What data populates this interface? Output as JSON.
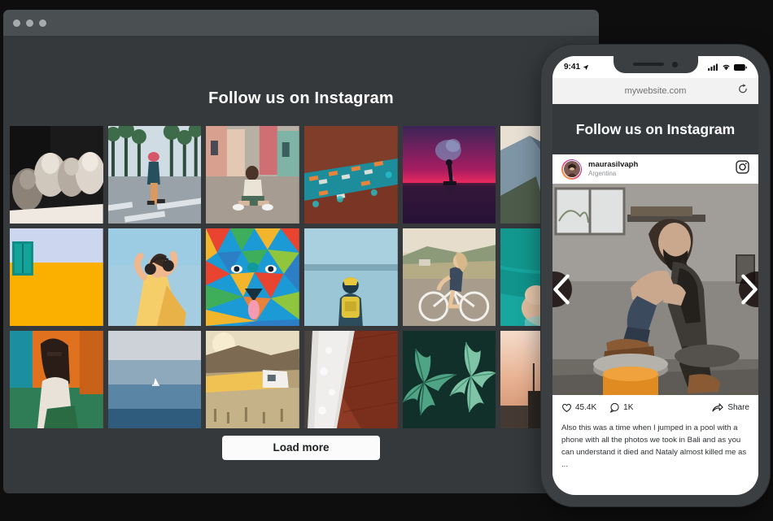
{
  "browser": {
    "title_bar_dots": 3,
    "heading": "Follow us on Instagram",
    "load_more_label": "Load more"
  },
  "photo_grid": {
    "columns": 6,
    "rows": 3,
    "tiles": [
      {
        "id": "tile-1",
        "alt": "Four friends laughing, black and white",
        "palette": [
          "#1b1b1b",
          "#d8d2cb",
          "#8a8075"
        ]
      },
      {
        "id": "tile-2",
        "alt": "Woman crossing palm-lined street",
        "palette": [
          "#c9d6de",
          "#2c4a5c",
          "#d9a06a"
        ]
      },
      {
        "id": "tile-3",
        "alt": "Woman sitting on colorful street",
        "palette": [
          "#cf8f7e",
          "#7ea9a0",
          "#b9b0a4"
        ]
      },
      {
        "id": "tile-4",
        "alt": "Aerial view of city traffic at dusk",
        "palette": [
          "#7a3b2c",
          "#1f9aa8",
          "#e0762f"
        ]
      },
      {
        "id": "tile-5",
        "alt": "Silhouette with smoke flare at sunset",
        "palette": [
          "#3a2050",
          "#e0255e",
          "#1b1030"
        ]
      },
      {
        "id": "tile-6",
        "alt": "Woman looking at mountain cliff",
        "palette": [
          "#e8ddd2",
          "#8fa6b5",
          "#4f5c52"
        ]
      },
      {
        "id": "tile-7",
        "alt": "Yellow wall with teal window",
        "palette": [
          "#ccd6ef",
          "#fbb000",
          "#0e8b84"
        ]
      },
      {
        "id": "tile-8",
        "alt": "Woman in yellow dress with headphones",
        "palette": [
          "#9cc8e0",
          "#f6cf6d",
          "#e8a24a"
        ]
      },
      {
        "id": "tile-9",
        "alt": "Geometric colorful bear mural",
        "palette": [
          "#e8442f",
          "#1b9ad6",
          "#3fae5a"
        ]
      },
      {
        "id": "tile-10",
        "alt": "Hiker with yellow backpack at lake",
        "palette": [
          "#9dc9d8",
          "#e8d14a",
          "#2f5d6e"
        ]
      },
      {
        "id": "tile-11",
        "alt": "Woman riding a bicycle on hill road",
        "palette": [
          "#d8cdb6",
          "#8e9a78",
          "#3d4552"
        ]
      },
      {
        "id": "tile-12",
        "alt": "Person in turquoise water",
        "palette": [
          "#16a8a0",
          "#0d7d82",
          "#e2c3a8"
        ]
      },
      {
        "id": "tile-13",
        "alt": "Woman in orange-lit room",
        "palette": [
          "#e0711e",
          "#2b2b2b",
          "#2f7d56"
        ]
      },
      {
        "id": "tile-14",
        "alt": "Sailboat on calm blue sea",
        "palette": [
          "#c6ccd2",
          "#4d7f9c",
          "#1f4a66"
        ]
      },
      {
        "id": "tile-15",
        "alt": "Yellow train in desert hills",
        "palette": [
          "#f0c264",
          "#8a7a5e",
          "#c9b48a"
        ]
      },
      {
        "id": "tile-16",
        "alt": "Waves crashing on red rock",
        "palette": [
          "#8d3b25",
          "#e6e6e4",
          "#5a2618"
        ]
      },
      {
        "id": "tile-17",
        "alt": "Green tropical leaves",
        "palette": [
          "#153026",
          "#4fa486",
          "#8fc9ad"
        ]
      },
      {
        "id": "tile-18",
        "alt": "City skyscraper at sunset",
        "palette": [
          "#f0cbb2",
          "#2a2320",
          "#d79b72"
        ]
      }
    ]
  },
  "phone": {
    "status_bar": {
      "time": "9:41",
      "location_icon": "location-arrow-icon",
      "signal_icon": "cellular-signal-icon",
      "wifi_icon": "wifi-icon",
      "battery_icon": "battery-icon"
    },
    "url_bar": {
      "url": "mywebsite.com",
      "reload_icon": "reload-icon"
    },
    "heading": "Follow us on Instagram",
    "post": {
      "username": "maurasilvaph",
      "location": "Argentina",
      "brand_icon": "instagram-icon",
      "photo_alt": "Bearded man in overalls sitting on steps lacing boots in workshop",
      "prev_icon": "chevron-left-icon",
      "next_icon": "chevron-right-icon",
      "likes": "45.4K",
      "comments": "1K",
      "like_icon": "heart-icon",
      "comment_icon": "comment-icon",
      "share_icon": "share-icon",
      "share_label": "Share",
      "caption": "Also this was a time when I jumped in a pool with a phone with all the photos we took in Bali and as you can understand it died and Nataly almost killed me as ..."
    }
  },
  "colors": {
    "page_bg": "#0e0e0f",
    "window_bg": "#35393b",
    "titlebar_bg": "#4a4f51",
    "phone_frame": "#3b3f41",
    "button_bg": "#fbfbfb",
    "text_light": "#ffffff"
  }
}
